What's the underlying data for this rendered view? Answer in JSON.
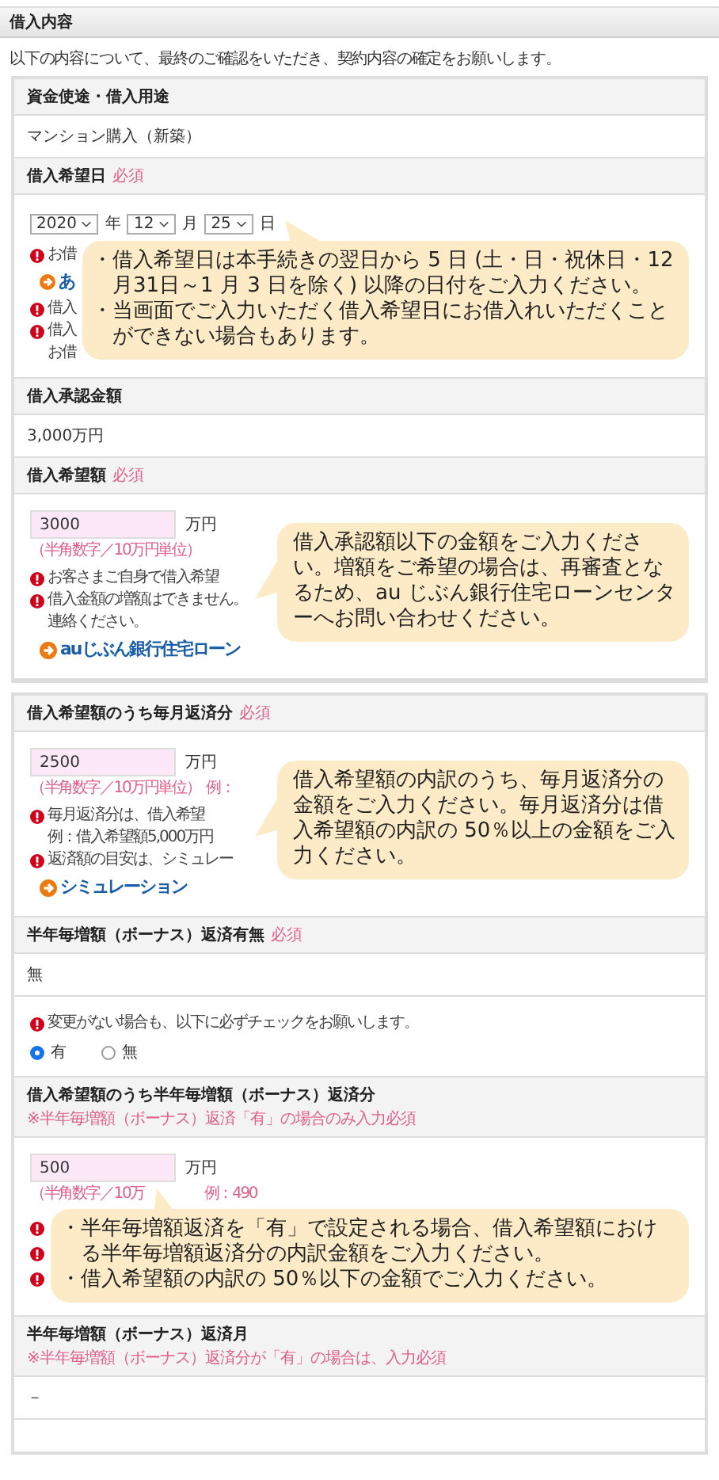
{
  "section_title": "借入内容",
  "intro": "以下の内容について、最終のご確認をいただき、契約内容の確定をお願いします。",
  "groups": [
    {
      "fields": [
        {
          "label": "資金使途・借入用途",
          "rows": [
            {
              "kind": "value",
              "text": "マンション購入（新築）"
            }
          ]
        },
        {
          "label": "借入希望日",
          "required": "必須",
          "rows": [
            {
              "kind": "date",
              "selects": [
                {
                  "value": "2020",
                  "unit": "年"
                },
                {
                  "value": "12",
                  "unit": "月"
                },
                {
                  "value": "25",
                  "unit": "日"
                }
              ],
              "notes": [
                {
                  "kind": "alert",
                  "text": "お借"
                },
                {
                  "kind": "link",
                  "text": "あ"
                },
                {
                  "kind": "alert",
                  "text": "借入"
                },
                {
                  "kind": "alert",
                  "text": "借入"
                },
                {
                  "kind": "plain",
                  "text": "お借"
                }
              ],
              "callout": {
                "kind": "bullets",
                "items": [
                  "・借入希望日は本手続きの翌日から 5 日 (土・日・祝休日・12 月31日～1 月 3 日を除く) 以降の日付をご入力ください。",
                  "・当画面でご入力いただく借入希望日にお借入れいただくことができない場合もあります。"
                ]
              }
            }
          ]
        },
        {
          "label": "借入承認金額",
          "rows": [
            {
              "kind": "value",
              "text": "3,000万円"
            }
          ]
        },
        {
          "label": "借入希望額",
          "required": "必須",
          "rows": [
            {
              "kind": "amount",
              "value": "3000",
              "unit": "万円",
              "hints": [
                "（半角数字／10万円単位）"
              ],
              "notes": [
                {
                  "kind": "alert",
                  "text": "お客さまご自身で借入希望"
                },
                {
                  "kind": "alert",
                  "text": "借入金額の増額はできません。"
                },
                {
                  "kind": "plain",
                  "text": "連絡ください。"
                },
                {
                  "kind": "link",
                  "text": "auじぶん銀行住宅ローン"
                }
              ],
              "callout": {
                "kind": "paragraph",
                "items": [
                  "借入承認額以下の金額をご入力ください。増額をご希望の場合は、再審査となるため、au じぶん銀行住宅ローンセンターへお問い合わせください。"
                ]
              }
            }
          ]
        }
      ]
    },
    {
      "fields": [
        {
          "label": "借入希望額のうち毎月返済分",
          "required": "必須",
          "rows": [
            {
              "kind": "amount",
              "value": "2500",
              "unit": "万円",
              "hints": [
                "（半角数字／10万円単位）",
                "例："
              ],
              "notes": [
                {
                  "kind": "alert",
                  "text": "毎月返済分は、借入希望"
                },
                {
                  "kind": "plain",
                  "text": "例：借入希望額5,000万円"
                },
                {
                  "kind": "alert",
                  "text": "返済額の目安は、シミュレー"
                },
                {
                  "kind": "link",
                  "text": "シミュレーション"
                }
              ],
              "callout": {
                "kind": "paragraph",
                "items": [
                  "借入希望額の内訳のうち、毎月返済分の金額をご入力ください。毎月返済分は借入希望額の内訳の 50％以上の金額をご入力ください。"
                ]
              }
            }
          ]
        },
        {
          "label": "半年毎増額（ボーナス）返済有無",
          "required": "必須",
          "rows": [
            {
              "kind": "value",
              "text": "無"
            },
            {
              "kind": "radio",
              "notes": [
                {
                  "kind": "alert",
                  "text": "変更がない場合も、以下に必ずチェックをお願いします。"
                }
              ],
              "options": [
                {
                  "label": "有",
                  "selected": true
                },
                {
                  "label": "無",
                  "selected": false
                }
              ]
            }
          ]
        },
        {
          "label": "借入希望額のうち半年毎増額（ボーナス）返済分",
          "label_note": "※半年毎増額（ボーナス）返済「有」の場合のみ入力必須",
          "rows": [
            {
              "kind": "amount",
              "value": "500",
              "unit": "万円",
              "hints": [
                "（半角数字／10万",
                "例：490"
              ],
              "notes": [
                {
                  "kind": "alert"
                },
                {
                  "kind": "alert"
                },
                {
                  "kind": "alert"
                }
              ],
              "callout": {
                "kind": "bullets",
                "items": [
                  "・半年毎増額返済を「有」で設定される場合、借入希望額における半年毎増額返済分の内訳金額をご入力ください。",
                  "・借入希望額の内訳の 50％以下の金額でご入力ください。"
                ]
              }
            }
          ]
        },
        {
          "label": "半年毎増額（ボーナス）返済月",
          "label_note": "※半年毎増額（ボーナス）返済分が「有」の場合は、入力必須",
          "rows": [
            {
              "kind": "value",
              "text": "－"
            },
            {
              "kind": "empty"
            }
          ]
        }
      ]
    }
  ]
}
